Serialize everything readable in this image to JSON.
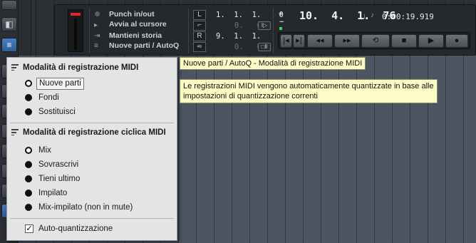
{
  "transport": {
    "punch_label": "Punch in/out",
    "start_at_cursor_label": "Avvia al cursore",
    "keep_history_label": "Mantieni storia",
    "new_parts_autoq_label": "Nuove parti / AutoQ",
    "locator_left_icon": "L",
    "locator_right_icon": "R",
    "left_locator": "1.  1.  1.    0",
    "left_offset": "0.   0",
    "right_locator": "9.  1.  1.    0",
    "right_offset": "0.   0",
    "position_bars": "10.  4.  1.  76",
    "position_time": "0:00:19.919",
    "buttons": {
      "go_to_start": "go-to-start-icon",
      "go_to_end": "go-to-end-icon",
      "rewind": "rewind-icon",
      "forward": "fast-forward-icon",
      "cycle": "cycle-icon",
      "stop": "stop-icon",
      "play": "play-icon",
      "record": "record-icon"
    }
  },
  "menu": {
    "section1_title": "Modalità di registrazione MIDI",
    "section1_items": [
      "Nuove parti",
      "Fondi",
      "Sostituisci"
    ],
    "section1_selected": "Nuove parti",
    "section2_title": "Modalità di registrazione ciclica MIDI",
    "section2_items": [
      "Mix",
      "Sovrascrivi",
      "Tieni ultimo",
      "Impilato",
      "Mix-impilato (non in mute)"
    ],
    "section2_selected": "Mix",
    "auto_quantize_label": "Auto-quantizzazione",
    "auto_quantize_checked": true
  },
  "tooltips": {
    "title": "Nuove parti / AutoQ - Modalità di registrazione MIDI",
    "description_line1": "Le registrazioni MIDI vengono automaticamente quantizzate in base alle",
    "description_line2": "impostazioni di quantizzazione correnti"
  },
  "colors": {
    "accent_blue": "#4a7fbf",
    "meter_red": "#e8212a",
    "tooltip_bg": "#fdfbc6",
    "menu_bg": "#e4e4e4"
  }
}
